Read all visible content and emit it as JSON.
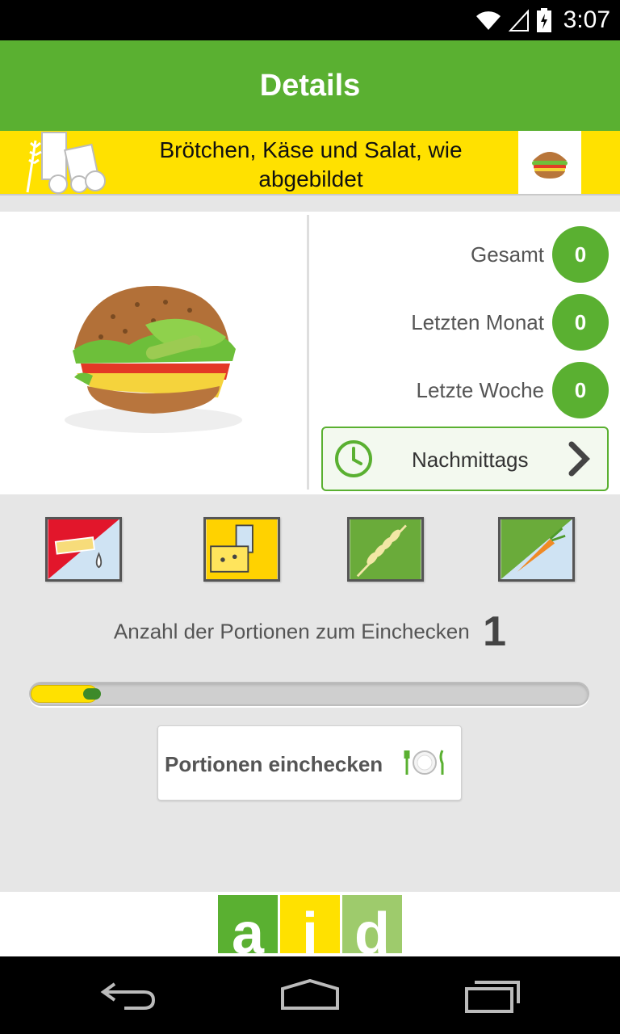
{
  "status_bar": {
    "time": "3:07"
  },
  "action_bar": {
    "title": "Details"
  },
  "food": {
    "name": "Brötchen, Käse und Salat, wie abgebildet"
  },
  "stats": [
    {
      "label": "Gesamt",
      "value": "0"
    },
    {
      "label": "Letzten Monat",
      "value": "0"
    },
    {
      "label": "Letzte Woche",
      "value": "0"
    }
  ],
  "time_of_day": {
    "label": "Nachmittags"
  },
  "food_groups": [
    "fats-oils-icon",
    "dairy-icon",
    "grains-icon",
    "vegetables-icon"
  ],
  "portions": {
    "label": "Anzahl der Portionen zum Einchecken",
    "count": "1",
    "slider_fraction": 0.12
  },
  "checkin_button": {
    "label": "Portionen einchecken"
  },
  "footer": {
    "logo_letters": [
      "a",
      "i",
      "d"
    ]
  },
  "colors": {
    "green": "#5ab031",
    "yellow": "#ffe100",
    "light_green": "#9ecb6c"
  }
}
